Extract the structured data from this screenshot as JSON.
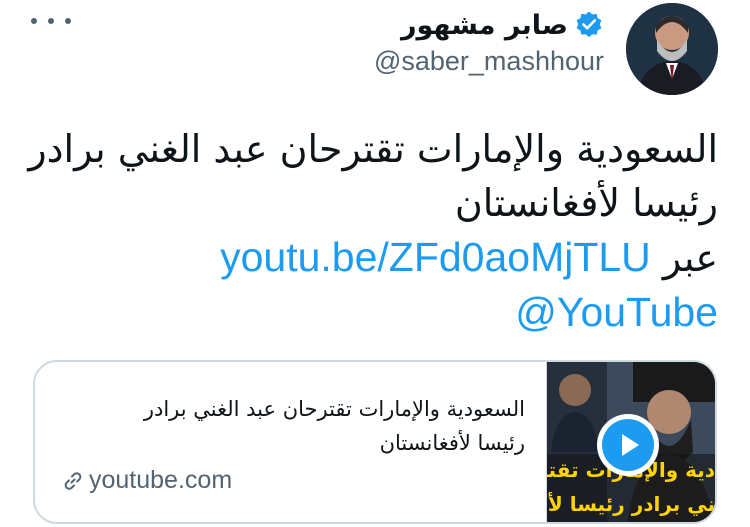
{
  "author": {
    "display_name": "صابر مشهور",
    "handle": "@saber_mashhour",
    "verified": true
  },
  "tweet": {
    "line1": "السعودية والإمارات تقترحان عبد الغني برادر",
    "line2": "رئيسا لأفغانستان",
    "link_text": "youtu.be/ZFd0aoMjTLU",
    "via_text": "عبر",
    "mention": "@YouTube"
  },
  "card": {
    "title_line1": "السعودية والإمارات تقترحان عبد الغني برادر",
    "title_line2": "رئيسا لأفغانستان",
    "domain": "youtube.com",
    "thumbnail_caption_line1": "دية والإمارات تقتـ",
    "thumbnail_caption_line2": "ني برادر رئيسا لأفغ"
  },
  "icons": {
    "verified": "verified-badge-icon",
    "more": "more-horizontal-icon",
    "play": "play-icon",
    "link": "link-icon"
  },
  "colors": {
    "accent": "#1d9bf0",
    "text": "#0f1419",
    "muted": "#536471",
    "border": "#cfd9de",
    "caption": "#ffd400"
  }
}
